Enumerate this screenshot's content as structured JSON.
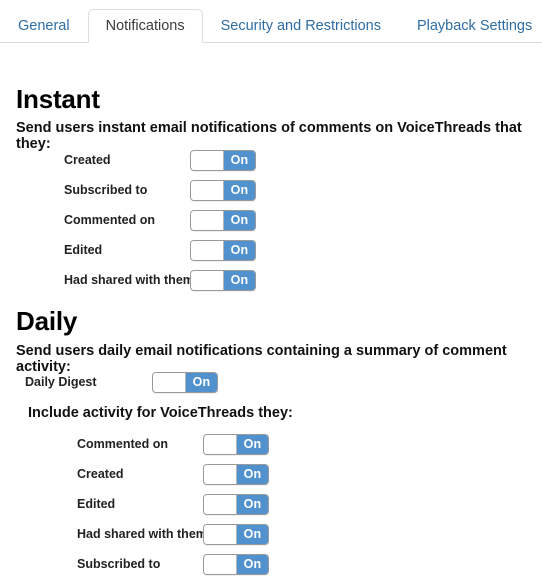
{
  "tabs": [
    {
      "label": "General",
      "active": false
    },
    {
      "label": "Notifications",
      "active": true
    },
    {
      "label": "Security and Restrictions",
      "active": false
    },
    {
      "label": "Playback Settings",
      "active": false
    }
  ],
  "colors": {
    "tab_link": "#2e6da4",
    "tab_active_text": "#3b3b3b",
    "toggle_on": "#5191ce",
    "border": "#dddddd"
  },
  "instant": {
    "title": "Instant",
    "description": "Send users instant email notifications of comments on VoiceThreads that they:",
    "rows": [
      {
        "label": "Created",
        "state": "On"
      },
      {
        "label": "Subscribed to",
        "state": "On"
      },
      {
        "label": "Commented on",
        "state": "On"
      },
      {
        "label": "Edited",
        "state": "On"
      },
      {
        "label": "Had shared with them",
        "state": "On"
      }
    ]
  },
  "daily": {
    "title": "Daily",
    "description": "Send users daily email notifications containing a summary of comment activity:",
    "digest": {
      "label": "Daily Digest",
      "state": "On"
    },
    "include_heading": "Include activity for VoiceThreads they:",
    "rows": [
      {
        "label": "Commented on",
        "state": "On"
      },
      {
        "label": "Created",
        "state": "On"
      },
      {
        "label": "Edited",
        "state": "On"
      },
      {
        "label": "Had shared with them",
        "state": "On"
      },
      {
        "label": "Subscribed to",
        "state": "On"
      }
    ]
  }
}
